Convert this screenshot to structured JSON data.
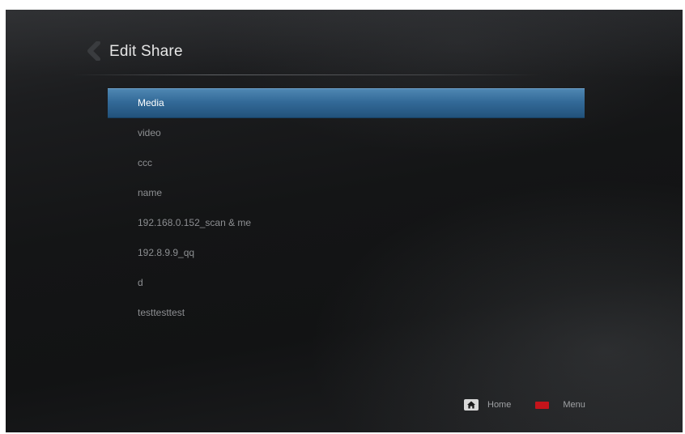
{
  "header": {
    "title": "Edit Share"
  },
  "share_list": {
    "selected_index": 0,
    "items": [
      {
        "label": "Media"
      },
      {
        "label": "video"
      },
      {
        "label": "ccc"
      },
      {
        "label": "name"
      },
      {
        "label": "192.168.0.152_scan & me"
      },
      {
        "label": "192.8.9.9_qq"
      },
      {
        "label": "d"
      },
      {
        "label": "testtesttest"
      }
    ]
  },
  "footer": {
    "home_label": "Home",
    "menu_label": "Menu",
    "home_icon": "home-icon",
    "menu_key_color": "#c4141b"
  },
  "colors": {
    "selection": "#336a98",
    "item_text": "#8d8f92",
    "background": "#141516"
  }
}
